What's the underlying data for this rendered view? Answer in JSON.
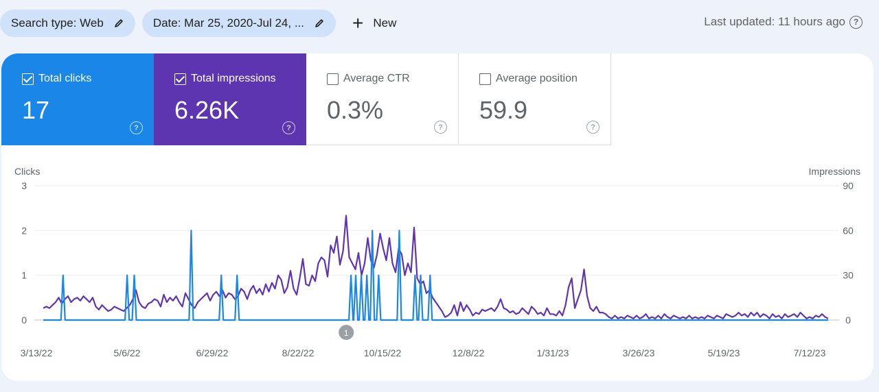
{
  "toolbar": {
    "search_type_chip": "Search type: Web",
    "date_chip": "Date: Mar 25, 2020-Jul 24, ...",
    "new_label": "New",
    "last_updated": "Last updated: 11 hours ago"
  },
  "metrics": [
    {
      "label": "Total clicks",
      "value": "17",
      "checked": true
    },
    {
      "label": "Total impressions",
      "value": "6.26K",
      "checked": true
    },
    {
      "label": "Average CTR",
      "value": "0.3%",
      "checked": false
    },
    {
      "label": "Average position",
      "value": "59.9",
      "checked": false
    }
  ],
  "colors": {
    "clicks": "#1a87e8",
    "impressions": "#5e35b1"
  },
  "chart_data": {
    "type": "line",
    "left_axis_label": "Clicks",
    "right_axis_label": "Impressions",
    "left_ylim": [
      0,
      3
    ],
    "right_ylim": [
      0,
      90
    ],
    "left_ticks": [
      "0",
      "1",
      "2",
      "3"
    ],
    "right_ticks": [
      "0",
      "30",
      "60",
      "90"
    ],
    "x_tick_labels": [
      "3/13/22",
      "5/6/22",
      "6/29/22",
      "8/22/22",
      "10/15/22",
      "12/8/22",
      "1/31/23",
      "3/26/23",
      "5/19/23",
      "7/12/23"
    ],
    "annotation": "1",
    "annotation_position_index": 0.383,
    "grid": true,
    "x_range_fraction": [
      0,
      1
    ],
    "series": [
      {
        "name": "Clicks",
        "axis": "left",
        "spikes": [
          {
            "x": 0.025,
            "value": 1
          },
          {
            "x": 0.106,
            "value": 1
          },
          {
            "x": 0.115,
            "value": 1
          },
          {
            "x": 0.187,
            "value": 2
          },
          {
            "x": 0.225,
            "value": 1
          },
          {
            "x": 0.245,
            "value": 1
          },
          {
            "x": 0.389,
            "value": 1
          },
          {
            "x": 0.395,
            "value": 1
          },
          {
            "x": 0.402,
            "value": 1
          },
          {
            "x": 0.409,
            "value": 1
          },
          {
            "x": 0.416,
            "value": 2
          },
          {
            "x": 0.424,
            "value": 1
          },
          {
            "x": 0.45,
            "value": 2
          },
          {
            "x": 0.47,
            "value": 1
          },
          {
            "x": 0.477,
            "value": 1
          },
          {
            "x": 0.489,
            "value": 1
          }
        ]
      },
      {
        "name": "Impressions",
        "axis": "right",
        "values": [
          8,
          9,
          8,
          10,
          12,
          15,
          11,
          14,
          16,
          12,
          14,
          15,
          13,
          16,
          14,
          12,
          15,
          9,
          7,
          10,
          8,
          6,
          7,
          9,
          8,
          7,
          6,
          8,
          10,
          14,
          20,
          12,
          9,
          8,
          11,
          12,
          14,
          13,
          9,
          17,
          12,
          15,
          13,
          16,
          12,
          9,
          18,
          14,
          10,
          8,
          12,
          14,
          16,
          18,
          13,
          17,
          19,
          16,
          20,
          15,
          18,
          17,
          14,
          16,
          21,
          19,
          14,
          20,
          23,
          18,
          21,
          17,
          24,
          19,
          25,
          21,
          30,
          27,
          18,
          22,
          33,
          21,
          17,
          28,
          41,
          24,
          23,
          30,
          26,
          38,
          42,
          40,
          29,
          50,
          45,
          56,
          37,
          46,
          70,
          42,
          38,
          34,
          45,
          30,
          38,
          55,
          40,
          35,
          44,
          58,
          48,
          40,
          55,
          38,
          32,
          48,
          44,
          30,
          38,
          32,
          62,
          28,
          24,
          26,
          18,
          20,
          15,
          12,
          9,
          6,
          2,
          3,
          5,
          10,
          3,
          12,
          6,
          10,
          7,
          3,
          5,
          4,
          7,
          6,
          7,
          8,
          6,
          9,
          14,
          8,
          7,
          5,
          6,
          4,
          5,
          8,
          6,
          4,
          9,
          7,
          4,
          5,
          3,
          8,
          4,
          4,
          3,
          6,
          3,
          10,
          22,
          28,
          8,
          14,
          20,
          34,
          16,
          8,
          6,
          9,
          5,
          5,
          4,
          2,
          1,
          3,
          1,
          2,
          1,
          3,
          2,
          1,
          3,
          1,
          2,
          4,
          1,
          2,
          1,
          3,
          1,
          4,
          2,
          1,
          3,
          2,
          1,
          2,
          1,
          3,
          1,
          2,
          1,
          2,
          1,
          3,
          2,
          1,
          3,
          2,
          1,
          4,
          3,
          2,
          3,
          5,
          3,
          4,
          2,
          5,
          3,
          5,
          2,
          4,
          3,
          1,
          4,
          2,
          3,
          1,
          4,
          2,
          3,
          4,
          2,
          5,
          3,
          1,
          2,
          1,
          3,
          2,
          4,
          2,
          1
        ]
      }
    ]
  }
}
